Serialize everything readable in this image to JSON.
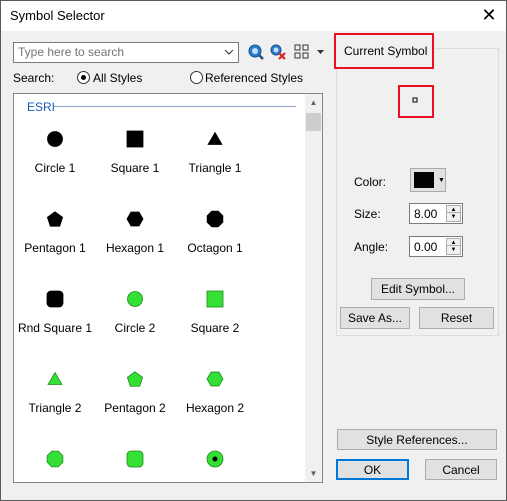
{
  "window": {
    "title": "Symbol Selector",
    "close_glyph": "✕"
  },
  "search": {
    "placeholder": "Type here to search",
    "scope_label": "Search:",
    "option_all": "All Styles",
    "option_referenced": "Referenced Styles"
  },
  "category": "ESRI",
  "symbols": [
    {
      "name": "Circle 1",
      "shape": "circle",
      "color": "#000000"
    },
    {
      "name": "Square 1",
      "shape": "square",
      "color": "#000000"
    },
    {
      "name": "Triangle 1",
      "shape": "triangle",
      "color": "#000000"
    },
    {
      "name": "Pentagon 1",
      "shape": "pentagon",
      "color": "#000000"
    },
    {
      "name": "Hexagon 1",
      "shape": "hexagon",
      "color": "#000000"
    },
    {
      "name": "Octagon 1",
      "shape": "octagon",
      "color": "#000000"
    },
    {
      "name": "Rnd Square 1",
      "shape": "roundsquare",
      "color": "#000000"
    },
    {
      "name": "Circle 2",
      "shape": "circle",
      "color": "#33e033"
    },
    {
      "name": "Square 2",
      "shape": "square",
      "color": "#33e033"
    },
    {
      "name": "Triangle 2",
      "shape": "triangle",
      "color": "#33e033"
    },
    {
      "name": "Pentagon 2",
      "shape": "pentagon",
      "color": "#33e033"
    },
    {
      "name": "Hexagon 2",
      "shape": "hexagon",
      "color": "#33e033"
    },
    {
      "name": "",
      "shape": "octagon",
      "color": "#33e033"
    },
    {
      "name": "",
      "shape": "roundsquare",
      "color": "#33e033"
    },
    {
      "name": "",
      "shape": "circledot",
      "color": "#33e033"
    }
  ],
  "current_symbol": {
    "title": "Current Symbol",
    "color_label": "Color:",
    "color_value": "#000000",
    "size_label": "Size:",
    "size_value": "8.00",
    "angle_label": "Angle:",
    "angle_value": "0.00",
    "edit_label": "Edit Symbol...",
    "save_as_label": "Save As...",
    "reset_label": "Reset"
  },
  "footer": {
    "style_references_label": "Style References...",
    "ok_label": "OK",
    "cancel_label": "Cancel"
  }
}
